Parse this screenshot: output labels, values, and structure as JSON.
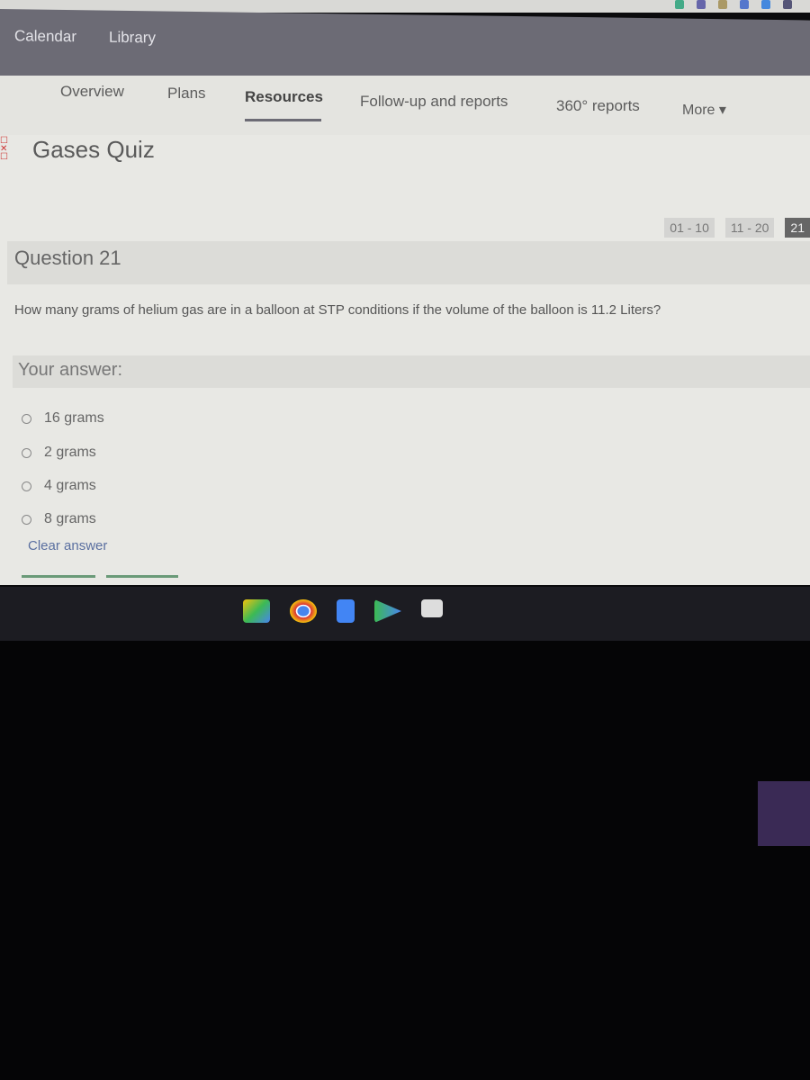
{
  "top_nav": {
    "items": [
      "Calendar",
      "Library"
    ]
  },
  "sub_nav": {
    "items": [
      "Overview",
      "Plans",
      "Resources",
      "Follow-up and reports",
      "360° reports",
      "More ▾"
    ],
    "active": "Resources"
  },
  "quiz": {
    "title": "Gases Quiz",
    "pager": [
      "01 - 10",
      "11 - 20",
      "21"
    ],
    "current_page": "21",
    "question_label": "Question 21",
    "question_text": "How many grams of helium gas are in a balloon at STP conditions if the volume of the balloon is 11.2 Liters?",
    "answer_label": "Your answer:",
    "options": [
      "16 grams",
      "2 grams",
      "4 grams",
      "8 grams"
    ],
    "clear_label": "Clear answer"
  },
  "shelf": {
    "apps": [
      "google-drive-icon",
      "chrome-icon",
      "google-docs-icon",
      "play-store-icon",
      "gmail-icon"
    ]
  },
  "colors": {
    "nav_bg": "#6c6b75",
    "page_bg": "#e8e8e4",
    "link": "#5a6fa0"
  }
}
